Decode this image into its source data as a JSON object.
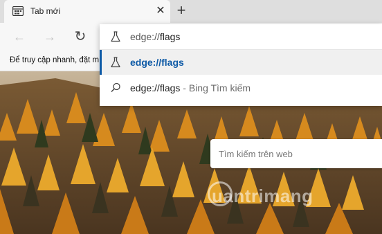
{
  "tab": {
    "title": "Tab mới",
    "close": "✕",
    "new": "+"
  },
  "toolbar": {
    "back": "←",
    "forward": "→",
    "reload": "↻"
  },
  "favorites_bar": {
    "text": "Để truy cập nhanh, đặt m"
  },
  "omnibox": {
    "input_prefix": "edge://",
    "input_typed": "flags",
    "suggestions": [
      {
        "text": "edge://flags",
        "icon": "flask-icon"
      },
      {
        "text": "edge://flags",
        "suffix": " - Bing Tìm kiếm",
        "icon": "search-icon"
      }
    ]
  },
  "page": {
    "search_placeholder": "Tìm kiếm trên web",
    "watermark": "uantrimang"
  },
  "colors": {
    "accent": "#0e5aa6"
  }
}
